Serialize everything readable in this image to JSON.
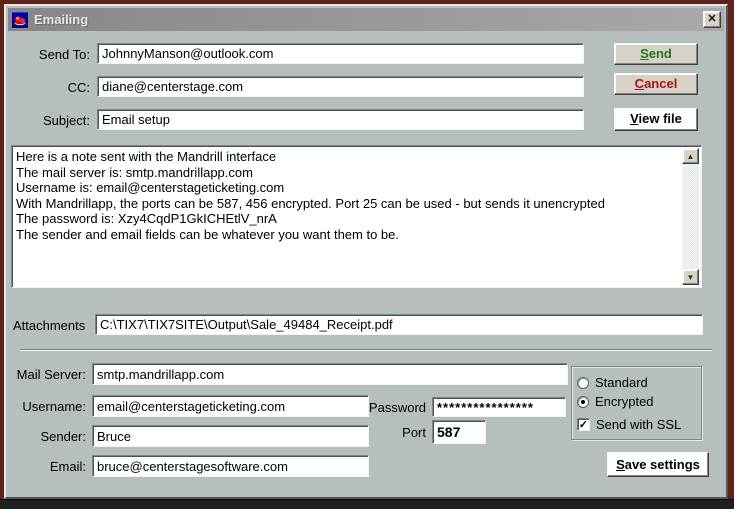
{
  "window": {
    "title": "Emailing"
  },
  "icons": {
    "close": "✕",
    "scroll_up": "▲",
    "scroll_down": "▼",
    "check": "✓"
  },
  "header_fields": {
    "send_to": {
      "label": "Send To:",
      "value": "JohnnyManson@outlook.com"
    },
    "cc": {
      "label": "CC:",
      "value": "diane@centerstage.com"
    },
    "subject": {
      "label": "Subject:",
      "value": "Email setup"
    }
  },
  "buttons": {
    "send": "Send",
    "cancel": "Cancel",
    "view_file": "View file",
    "save_settings": "Save settings"
  },
  "note": {
    "lines": [
      "Here is a note sent with the Mandrill interface",
      "The mail server is: smtp.mandrillapp.com",
      "Username is: email@centerstageticketing.com",
      "With Mandrillapp, the ports can be 587, 456 encrypted. Port 25 can be used - but sends it unencrypted",
      "The password is: Xzy4CqdP1GkICHEtlV_nrA",
      "The sender and email fields can be whatever you want them to be."
    ]
  },
  "attachments": {
    "label": "Attachments",
    "value": "C:\\TIX7\\TIX7SITE\\Output\\Sale_49484_Receipt.pdf"
  },
  "settings": {
    "mail_server": {
      "label": "Mail Server:",
      "value": "smtp.mandrillapp.com"
    },
    "username": {
      "label": "Username:",
      "value": "email@centerstageticketing.com"
    },
    "password": {
      "label": "Password",
      "value": "****************"
    },
    "sender": {
      "label": "Sender:",
      "value": "Bruce"
    },
    "port": {
      "label": "Port",
      "value": "587"
    },
    "email": {
      "label": "Email:",
      "value": "bruce@centerstagesoftware.com"
    },
    "options": {
      "standard": {
        "label": "Standard",
        "selected": false
      },
      "encrypted": {
        "label": "Encrypted",
        "selected": true
      },
      "ssl": {
        "label": "Send with SSL",
        "checked": true
      }
    }
  },
  "colors": {
    "dialog_bg": "#b6bfbd",
    "send_text": "#1f7a1f",
    "cancel_text": "#aa1414",
    "titlebar": "#949494",
    "background_edge": "#60231b"
  }
}
